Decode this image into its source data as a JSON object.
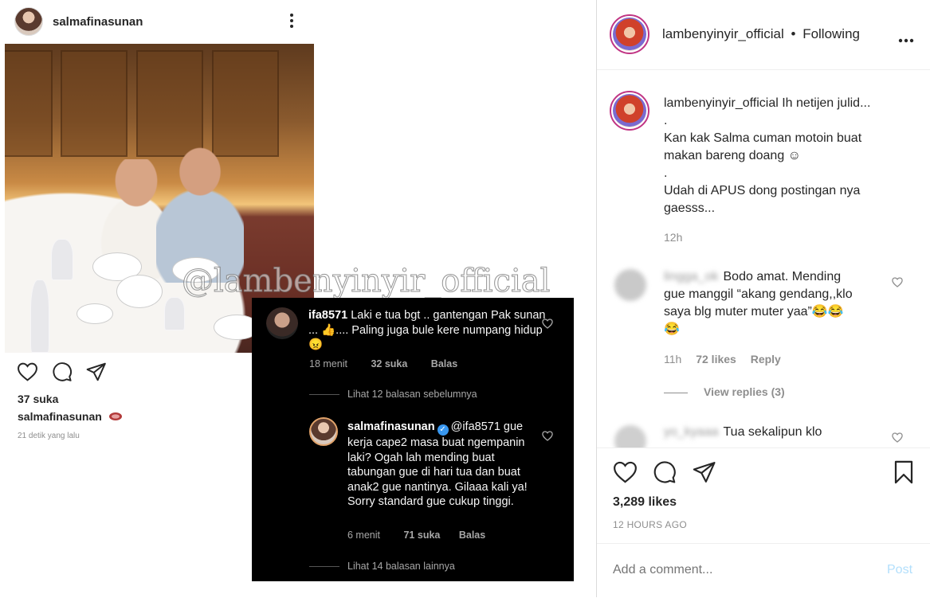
{
  "left_post": {
    "username": "salmafinasunan",
    "likes": "37 suka",
    "caption_user": "salmafinasunan",
    "time": "21 detik yang lalu"
  },
  "watermark": "@lambenyinyir_official",
  "dark_comments": {
    "c1": {
      "user": "ifa8571",
      "text": "Laki e tua bgt .. gantengan Pak sunan ... 👍.... Paling juga bule kere numpang hidup😠",
      "time": "18 menit",
      "likes": "32 suka",
      "reply": "Balas"
    },
    "view_prev": "Lihat 12 balasan sebelumnya",
    "c2": {
      "user": "salmafinasunan",
      "mention": "@ifa8571",
      "text": "gue kerja cape2 masa buat ngempanin laki? Ogah lah mending buat tabungan gue di hari tua dan buat anak2 gue nantinya. Gilaaa kali ya! Sorry standard gue cukup tinggi.",
      "time": "6 menit",
      "likes": "71 suka",
      "reply": "Balas"
    },
    "view_more": "Lihat 14 balasan lainnya"
  },
  "right": {
    "header_user": "lambenyinyir_official",
    "follow_sep": "•",
    "follow": "Following",
    "caption_user": "lambenyinyir_official",
    "caption_lines": [
      "Ih netijen julid...",
      ".",
      "Kan kak Salma cuman motoin buat",
      "makan bareng doang ☺",
      ".",
      "Udah di APUS dong postingan nya",
      "gaesss..."
    ],
    "caption_time": "12h",
    "comment1": {
      "user": "lingga_ok",
      "text_lines": [
        "Bodo amat. Mending",
        "gue manggil “akang gendang,,klo",
        "saya blg muter muter yaa”😂😂",
        "😂"
      ],
      "time": "11h",
      "likes": "72 likes",
      "reply": "Reply",
      "view_replies": "View replies (3)"
    },
    "comment2": {
      "user": "yo_kyaaa",
      "text": "Tua sekalipun klo"
    },
    "likes": "3,289 likes",
    "ago": "12 HOURS AGO",
    "add_comment_placeholder": "Add a comment...",
    "post": "Post"
  },
  "colors": {
    "accent_blue": "#3897f0",
    "post_disabled": "#b2dffc",
    "dark_bg": "#000000"
  }
}
